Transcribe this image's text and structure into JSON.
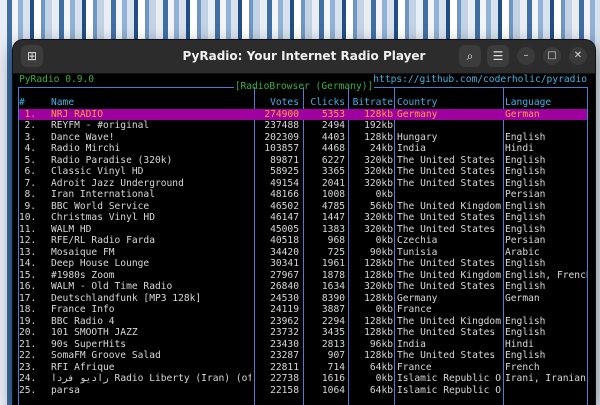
{
  "window": {
    "title": "PyRadio: Your Internet Radio Player",
    "buttons": {
      "search": "⌕",
      "menu": "☰",
      "minimize": "–",
      "maximize": "□",
      "close": "✕"
    }
  },
  "terminal": {
    "version": "PyRadio 0.9.0",
    "url": "https://github.com/coderholic/pyradio",
    "box_title": "[RadioBrowser (Germany)]",
    "columns": {
      "num": "#",
      "name": "Name",
      "votes": "Votes",
      "clicks": "Clicks",
      "bitrate": "Bitrate",
      "country": "Country",
      "language": "Language"
    }
  },
  "colors": {
    "selection_bg": "#a000a0",
    "selection_fg": "#ff9a40",
    "header": "#3fb3e3",
    "accent_green": "#3cb043",
    "border": "#4a7fd0"
  },
  "stations": [
    {
      "num": "1.",
      "name": "NRJ RADIO",
      "votes": "274900",
      "clicks": "5353",
      "bitrate": "128kb",
      "country": "Germany",
      "language": "German",
      "selected": true
    },
    {
      "num": "2.",
      "name": "REYFM - #original",
      "votes": "237488",
      "clicks": "2494",
      "bitrate": "192kb",
      "country": "",
      "language": ""
    },
    {
      "num": "3.",
      "name": "Dance Wave!",
      "votes": "202309",
      "clicks": "4403",
      "bitrate": "128kb",
      "country": "Hungary",
      "language": "English"
    },
    {
      "num": "4.",
      "name": "Radio Mirchi",
      "votes": "103857",
      "clicks": "4468",
      "bitrate": "24kb",
      "country": "India",
      "language": "Hindi"
    },
    {
      "num": "5.",
      "name": "Radio Paradise (320k)",
      "votes": "89871",
      "clicks": "6227",
      "bitrate": "320kb",
      "country": "The United States",
      "language": "English"
    },
    {
      "num": "6.",
      "name": "Classic Vinyl HD",
      "votes": "58925",
      "clicks": "3365",
      "bitrate": "320kb",
      "country": "The United States",
      "language": "English"
    },
    {
      "num": "7.",
      "name": "Adroit Jazz Underground",
      "votes": "49154",
      "clicks": "2041",
      "bitrate": "320kb",
      "country": "The United States",
      "language": "English"
    },
    {
      "num": "8.",
      "name": "Iran International",
      "votes": "48166",
      "clicks": "1008",
      "bitrate": "0kb",
      "country": "",
      "language": "Persian"
    },
    {
      "num": "9.",
      "name": "BBC World Service",
      "votes": "46502",
      "clicks": "4785",
      "bitrate": "56kb",
      "country": "The United Kingdom",
      "language": "English"
    },
    {
      "num": "10.",
      "name": "Christmas Vinyl HD",
      "votes": "46147",
      "clicks": "1447",
      "bitrate": "320kb",
      "country": "The United States",
      "language": "English"
    },
    {
      "num": "11.",
      "name": "WALM HD",
      "votes": "45005",
      "clicks": "1383",
      "bitrate": "320kb",
      "country": "The United States",
      "language": "English"
    },
    {
      "num": "12.",
      "name": "RFE/RL Radio Farda",
      "votes": "40518",
      "clicks": "968",
      "bitrate": "0kb",
      "country": "Czechia",
      "language": "Persian"
    },
    {
      "num": "13.",
      "name": "Mosaique FM",
      "votes": "34420",
      "clicks": "725",
      "bitrate": "90kb",
      "country": "Tunisia",
      "language": "Arabic"
    },
    {
      "num": "14.",
      "name": "Deep House Lounge",
      "votes": "30341",
      "clicks": "1961",
      "bitrate": "128kb",
      "country": "The United States",
      "language": "English"
    },
    {
      "num": "15.",
      "name": "#1980s Zoom",
      "votes": "27967",
      "clicks": "1878",
      "bitrate": "128kb",
      "country": "The United Kingdom",
      "language": "English, French"
    },
    {
      "num": "16.",
      "name": "WALM - Old Time Radio",
      "votes": "26840",
      "clicks": "1634",
      "bitrate": "320kb",
      "country": "The United States",
      "language": "English"
    },
    {
      "num": "17.",
      "name": "Deutschlandfunk [MP3 128k]",
      "votes": "24530",
      "clicks": "8390",
      "bitrate": "128kb",
      "country": "Germany",
      "language": "German"
    },
    {
      "num": "18.",
      "name": "France Info",
      "votes": "24119",
      "clicks": "3887",
      "bitrate": "0kb",
      "country": "France",
      "language": ""
    },
    {
      "num": "19.",
      "name": "BBC Radio 4",
      "votes": "23962",
      "clicks": "2294",
      "bitrate": "128kb",
      "country": "The United Kingdom",
      "language": "English"
    },
    {
      "num": "20.",
      "name": "101 SMOOTH JAZZ",
      "votes": "23732",
      "clicks": "3435",
      "bitrate": "128kb",
      "country": "The United States",
      "language": "English"
    },
    {
      "num": "21.",
      "name": "90s SuperHits",
      "votes": "23430",
      "clicks": "2813",
      "bitrate": "96kb",
      "country": "India",
      "language": "Hindi"
    },
    {
      "num": "22.",
      "name": "SomaFM Groove Salad",
      "votes": "23287",
      "clicks": "907",
      "bitrate": "128kb",
      "country": "The United States",
      "language": "English"
    },
    {
      "num": "23.",
      "name": "RFI Afrique",
      "votes": "22811",
      "clicks": "714",
      "bitrate": "64kb",
      "country": "France",
      "language": "French"
    },
    {
      "num": "24.",
      "name": "رادیو فردا Radio Liberty (Iran) (off",
      "votes": "22738",
      "clicks": "1616",
      "bitrate": "0kb",
      "country": "Islamic Republic O",
      "language": "Irani, Iranian"
    },
    {
      "num": "25.",
      "name": "parsa",
      "votes": "22158",
      "clicks": "1064",
      "bitrate": "64kb",
      "country": "Islamic Republic O",
      "language": ""
    }
  ]
}
